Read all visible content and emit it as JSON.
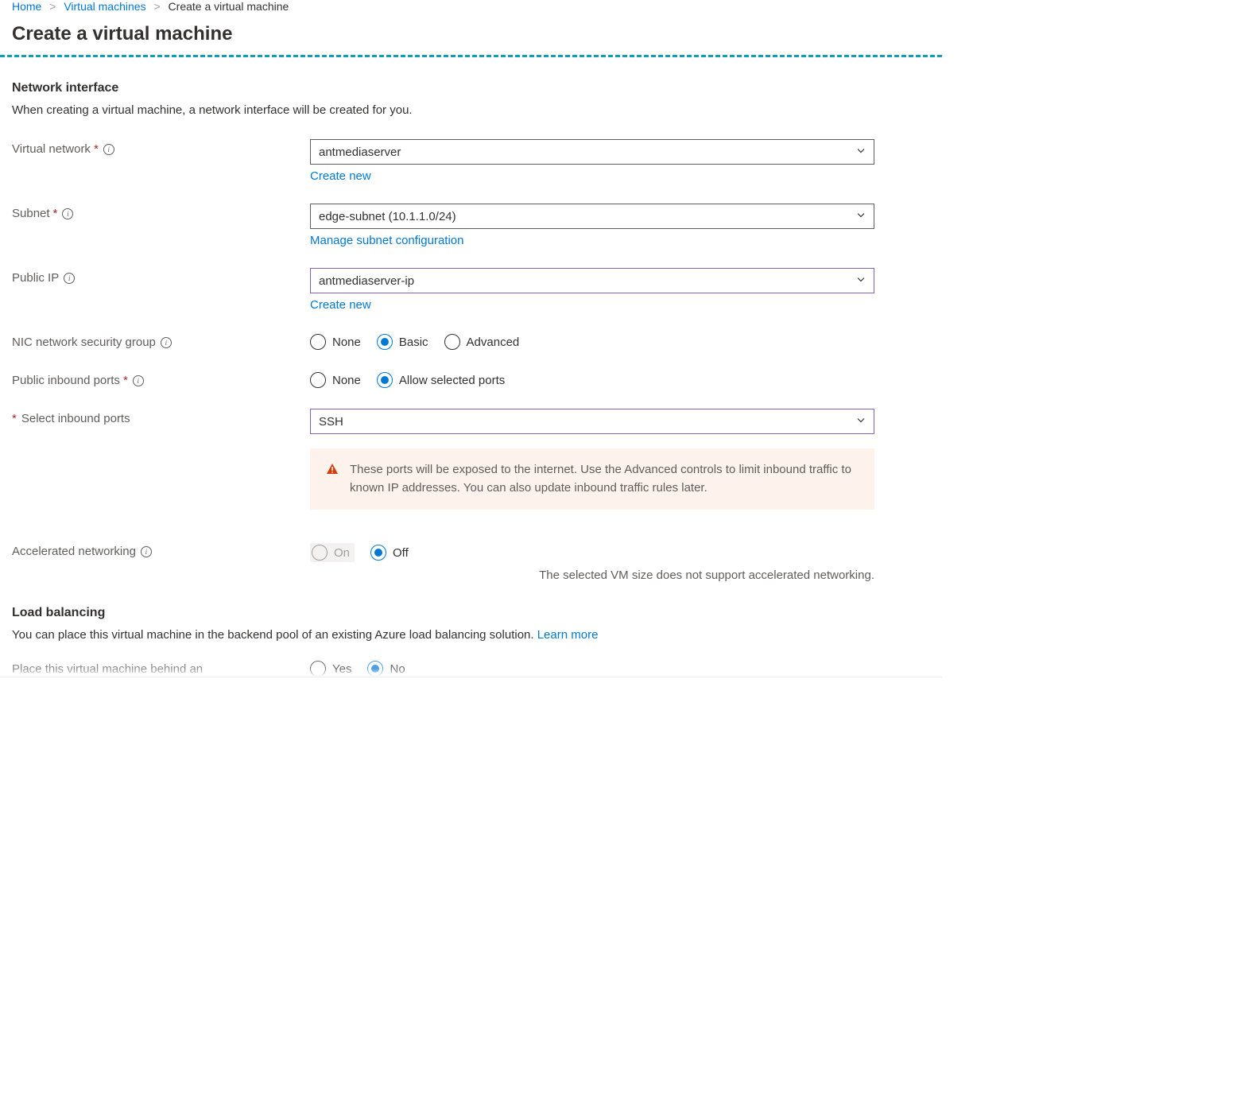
{
  "breadcrumb": {
    "home": "Home",
    "vms": "Virtual machines",
    "current": "Create a virtual machine"
  },
  "page_title": "Create a virtual machine",
  "network_interface": {
    "heading": "Network interface",
    "description": "When creating a virtual machine, a network interface will be created for you."
  },
  "virtual_network": {
    "label": "Virtual network",
    "value": "antmediaserver",
    "create_new": "Create new"
  },
  "subnet": {
    "label": "Subnet",
    "value": "edge-subnet (10.1.1.0/24)",
    "manage": "Manage subnet configuration"
  },
  "public_ip": {
    "label": "Public IP",
    "value": "antmediaserver-ip",
    "create_new": "Create new"
  },
  "nsg": {
    "label": "NIC network security group",
    "options": {
      "none": "None",
      "basic": "Basic",
      "advanced": "Advanced"
    }
  },
  "inbound_ports": {
    "label": "Public inbound ports",
    "options": {
      "none": "None",
      "allow": "Allow selected ports"
    }
  },
  "select_inbound": {
    "label": "Select inbound ports",
    "value": "SSH"
  },
  "warning_text": "These ports will be exposed to the internet. Use the Advanced controls to limit inbound traffic to known IP addresses. You can also update inbound traffic rules later.",
  "accelerated": {
    "label": "Accelerated networking",
    "options": {
      "on": "On",
      "off": "Off"
    },
    "help": "The selected VM size does not support accelerated networking."
  },
  "load_balancing": {
    "heading": "Load balancing",
    "description": "You can place this virtual machine in the backend pool of an existing Azure load balancing solution.  ",
    "learn_more": "Learn more"
  },
  "behind_lb": {
    "label": "Place this virtual machine behind an",
    "options": {
      "yes": "Yes",
      "no": "No"
    }
  }
}
